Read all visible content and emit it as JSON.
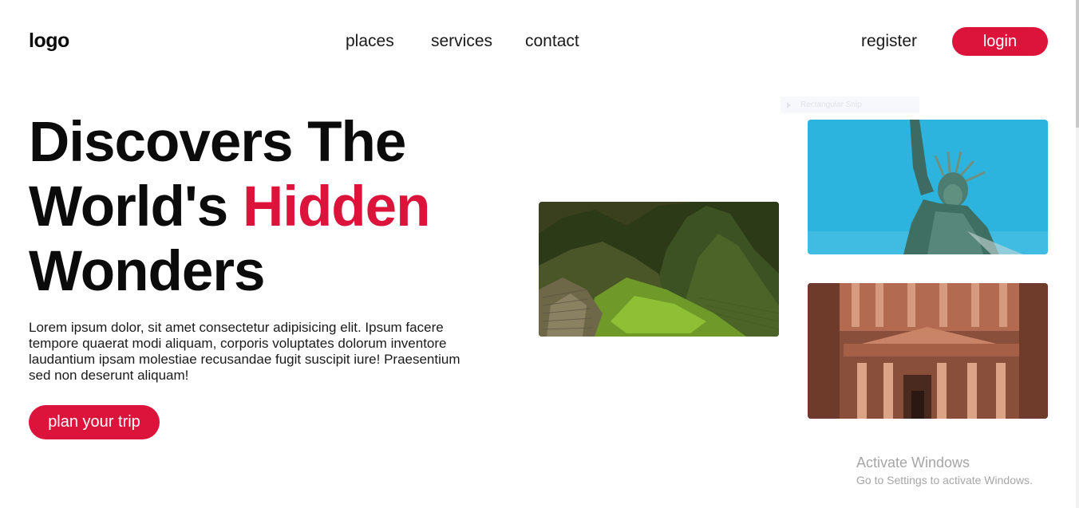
{
  "header": {
    "logo": "logo",
    "nav": [
      "places",
      "services",
      "contact"
    ],
    "register": "register",
    "login": "login"
  },
  "hero": {
    "title_line1": "Discovers The",
    "title_line2_plain": "World's ",
    "title_line2_accent": "Hidden",
    "title_line3": "Wonders",
    "description": "Lorem ipsum dolor, sit amet consectetur adipisicing elit. Ipsum facere tempore quaerat modi aliquam, corporis voluptates dolorum inventore laudantium ipsam molestiae recusandae fugit suscipit iure! Praesentium sed non deserunt aliquam!",
    "cta": "plan your trip"
  },
  "overlay": {
    "chip_text": "Rectangular Snip"
  },
  "watermark": {
    "title": "Activate Windows",
    "subtitle": "Go to Settings to activate Windows."
  },
  "colors": {
    "accent": "#dc143c",
    "text": "#0b0b0b",
    "sky": "#2db4de"
  }
}
